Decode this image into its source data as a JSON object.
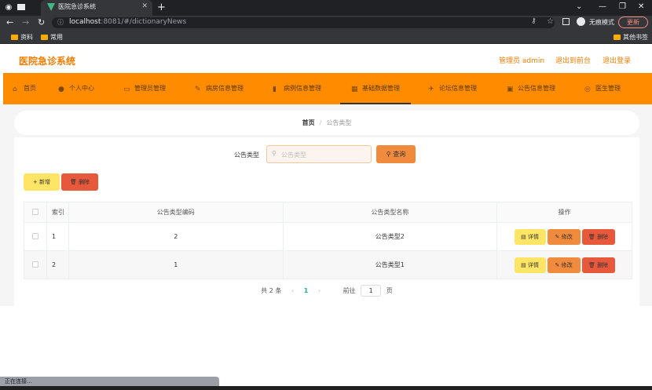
{
  "browser": {
    "tab_title": "医院急诊系统",
    "url_host": "localhost",
    "url_rest": ":8081/#/dictionaryNews",
    "incognito_label": "无痕模式",
    "update_label": "更新",
    "bookmarks": [
      "资料",
      "常用"
    ],
    "other_bookmarks": "其他书签",
    "status_text": "正在连接..."
  },
  "header": {
    "title": "医院急诊系统",
    "admin_link": "管理员 admin",
    "front_link": "退出到前台",
    "logout_link": "退出登录"
  },
  "menu": {
    "items": [
      {
        "label": "首页",
        "icon": "home-icon"
      },
      {
        "label": "个人中心",
        "icon": "user-icon"
      },
      {
        "label": "管理员管理",
        "icon": "admin-icon"
      },
      {
        "label": "病房信息管理",
        "icon": "ward-icon"
      },
      {
        "label": "病例信息管理",
        "icon": "chart-icon"
      },
      {
        "label": "基础数据管理",
        "icon": "data-icon"
      },
      {
        "label": "论坛信息管理",
        "icon": "forum-icon"
      },
      {
        "label": "公告信息管理",
        "icon": "notice-icon"
      },
      {
        "label": "医生管理",
        "icon": "doctor-icon"
      }
    ],
    "active_index": 5
  },
  "breadcrumb": {
    "home": "首页",
    "separator": "/",
    "current": "公告类型"
  },
  "search": {
    "label": "公告类型",
    "placeholder": "公告类型",
    "query_button": "查询"
  },
  "actions": {
    "add": "新增",
    "delete": "删除"
  },
  "table": {
    "columns": [
      "索引",
      "公告类型编码",
      "公告类型名称",
      "操作"
    ],
    "rows": [
      {
        "index": "1",
        "code": "2",
        "name": "公告类型2"
      },
      {
        "index": "2",
        "code": "1",
        "name": "公告类型1"
      }
    ],
    "row_actions": {
      "detail": "详情",
      "edit": "修改",
      "delete": "删除"
    }
  },
  "pagination": {
    "total": "共 2 条",
    "current_page": "1",
    "goto_label": "前往",
    "goto_value": "1",
    "page_suffix": "页"
  },
  "colors": {
    "accent": "#ff8c00",
    "title": "#f57c00",
    "yellow_button": "#ffe566",
    "orange_button": "#f08a3c",
    "red_button": "#e8593c"
  }
}
